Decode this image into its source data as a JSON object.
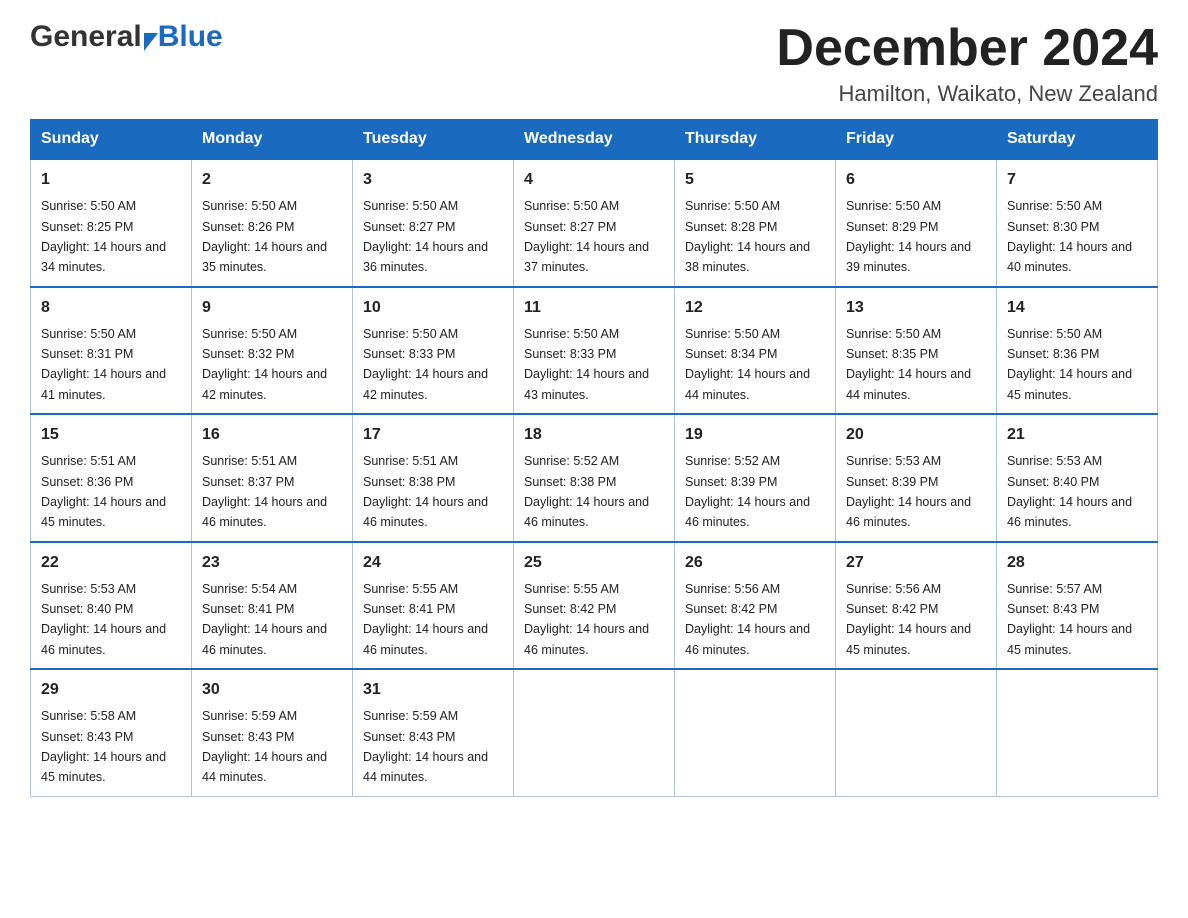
{
  "header": {
    "logo_general": "General",
    "logo_blue": "Blue",
    "month_title": "December 2024",
    "location": "Hamilton, Waikato, New Zealand"
  },
  "calendar": {
    "days_of_week": [
      "Sunday",
      "Monday",
      "Tuesday",
      "Wednesday",
      "Thursday",
      "Friday",
      "Saturday"
    ],
    "weeks": [
      [
        {
          "day": "1",
          "sunrise": "5:50 AM",
          "sunset": "8:25 PM",
          "daylight": "14 hours and 34 minutes."
        },
        {
          "day": "2",
          "sunrise": "5:50 AM",
          "sunset": "8:26 PM",
          "daylight": "14 hours and 35 minutes."
        },
        {
          "day": "3",
          "sunrise": "5:50 AM",
          "sunset": "8:27 PM",
          "daylight": "14 hours and 36 minutes."
        },
        {
          "day": "4",
          "sunrise": "5:50 AM",
          "sunset": "8:27 PM",
          "daylight": "14 hours and 37 minutes."
        },
        {
          "day": "5",
          "sunrise": "5:50 AM",
          "sunset": "8:28 PM",
          "daylight": "14 hours and 38 minutes."
        },
        {
          "day": "6",
          "sunrise": "5:50 AM",
          "sunset": "8:29 PM",
          "daylight": "14 hours and 39 minutes."
        },
        {
          "day": "7",
          "sunrise": "5:50 AM",
          "sunset": "8:30 PM",
          "daylight": "14 hours and 40 minutes."
        }
      ],
      [
        {
          "day": "8",
          "sunrise": "5:50 AM",
          "sunset": "8:31 PM",
          "daylight": "14 hours and 41 minutes."
        },
        {
          "day": "9",
          "sunrise": "5:50 AM",
          "sunset": "8:32 PM",
          "daylight": "14 hours and 42 minutes."
        },
        {
          "day": "10",
          "sunrise": "5:50 AM",
          "sunset": "8:33 PM",
          "daylight": "14 hours and 42 minutes."
        },
        {
          "day": "11",
          "sunrise": "5:50 AM",
          "sunset": "8:33 PM",
          "daylight": "14 hours and 43 minutes."
        },
        {
          "day": "12",
          "sunrise": "5:50 AM",
          "sunset": "8:34 PM",
          "daylight": "14 hours and 44 minutes."
        },
        {
          "day": "13",
          "sunrise": "5:50 AM",
          "sunset": "8:35 PM",
          "daylight": "14 hours and 44 minutes."
        },
        {
          "day": "14",
          "sunrise": "5:50 AM",
          "sunset": "8:36 PM",
          "daylight": "14 hours and 45 minutes."
        }
      ],
      [
        {
          "day": "15",
          "sunrise": "5:51 AM",
          "sunset": "8:36 PM",
          "daylight": "14 hours and 45 minutes."
        },
        {
          "day": "16",
          "sunrise": "5:51 AM",
          "sunset": "8:37 PM",
          "daylight": "14 hours and 46 minutes."
        },
        {
          "day": "17",
          "sunrise": "5:51 AM",
          "sunset": "8:38 PM",
          "daylight": "14 hours and 46 minutes."
        },
        {
          "day": "18",
          "sunrise": "5:52 AM",
          "sunset": "8:38 PM",
          "daylight": "14 hours and 46 minutes."
        },
        {
          "day": "19",
          "sunrise": "5:52 AM",
          "sunset": "8:39 PM",
          "daylight": "14 hours and 46 minutes."
        },
        {
          "day": "20",
          "sunrise": "5:53 AM",
          "sunset": "8:39 PM",
          "daylight": "14 hours and 46 minutes."
        },
        {
          "day": "21",
          "sunrise": "5:53 AM",
          "sunset": "8:40 PM",
          "daylight": "14 hours and 46 minutes."
        }
      ],
      [
        {
          "day": "22",
          "sunrise": "5:53 AM",
          "sunset": "8:40 PM",
          "daylight": "14 hours and 46 minutes."
        },
        {
          "day": "23",
          "sunrise": "5:54 AM",
          "sunset": "8:41 PM",
          "daylight": "14 hours and 46 minutes."
        },
        {
          "day": "24",
          "sunrise": "5:55 AM",
          "sunset": "8:41 PM",
          "daylight": "14 hours and 46 minutes."
        },
        {
          "day": "25",
          "sunrise": "5:55 AM",
          "sunset": "8:42 PM",
          "daylight": "14 hours and 46 minutes."
        },
        {
          "day": "26",
          "sunrise": "5:56 AM",
          "sunset": "8:42 PM",
          "daylight": "14 hours and 46 minutes."
        },
        {
          "day": "27",
          "sunrise": "5:56 AM",
          "sunset": "8:42 PM",
          "daylight": "14 hours and 45 minutes."
        },
        {
          "day": "28",
          "sunrise": "5:57 AM",
          "sunset": "8:43 PM",
          "daylight": "14 hours and 45 minutes."
        }
      ],
      [
        {
          "day": "29",
          "sunrise": "5:58 AM",
          "sunset": "8:43 PM",
          "daylight": "14 hours and 45 minutes."
        },
        {
          "day": "30",
          "sunrise": "5:59 AM",
          "sunset": "8:43 PM",
          "daylight": "14 hours and 44 minutes."
        },
        {
          "day": "31",
          "sunrise": "5:59 AM",
          "sunset": "8:43 PM",
          "daylight": "14 hours and 44 minutes."
        },
        null,
        null,
        null,
        null
      ]
    ]
  }
}
